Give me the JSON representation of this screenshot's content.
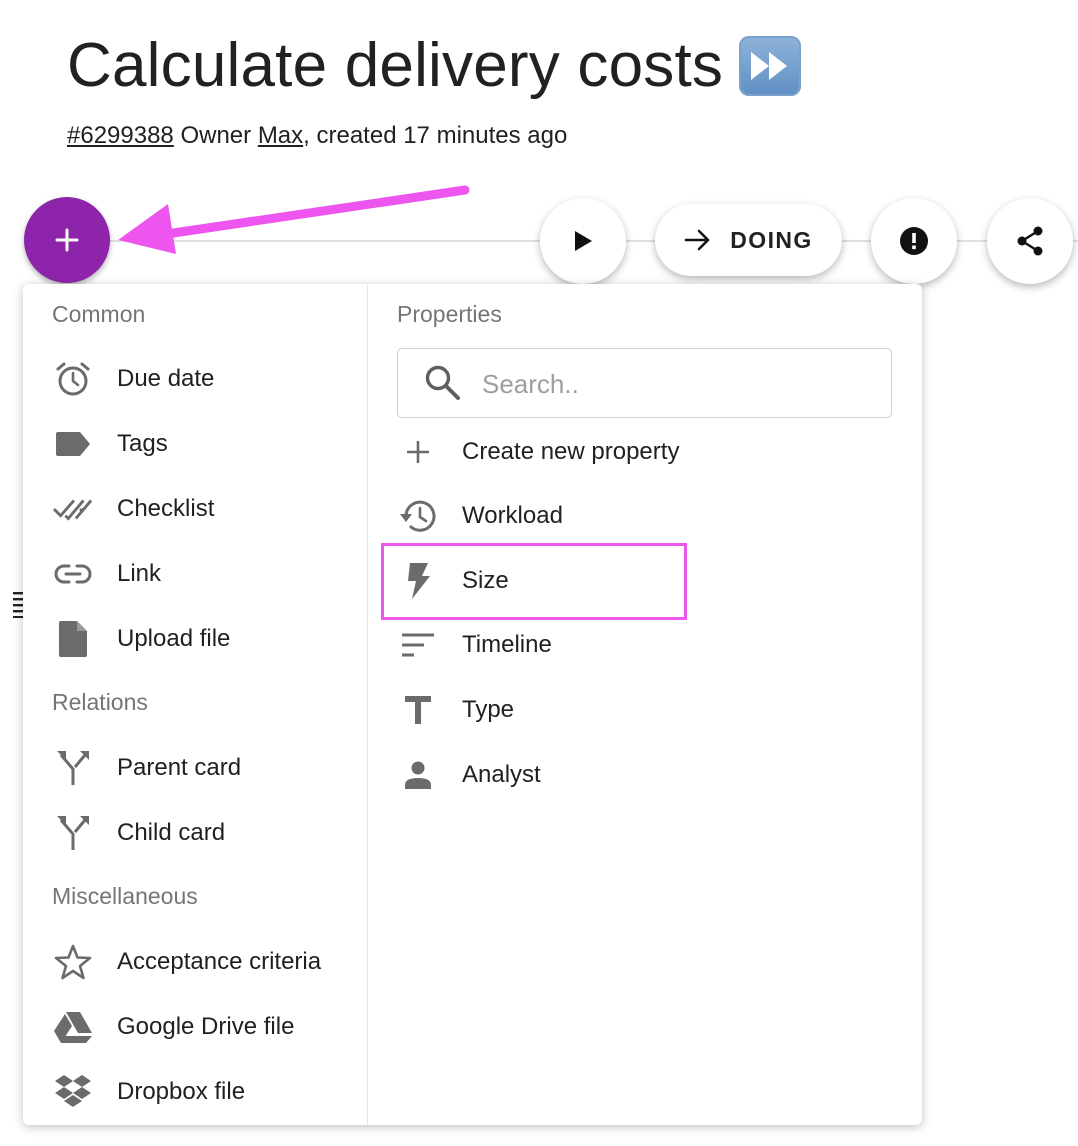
{
  "card": {
    "title": "Calculate delivery costs",
    "title_emoji": "fast-forward-emoji",
    "id": "#6299388",
    "owner_prefix": "Owner",
    "owner": "Max",
    "created": ", created 17 minutes ago"
  },
  "toolbar": {
    "add_icon": "plus-icon",
    "play_icon": "play-icon",
    "status_label": "DOING",
    "status_icon": "arrow-right-icon",
    "alert_icon": "exclamation-icon",
    "share_icon": "share-icon"
  },
  "menu": {
    "common": {
      "heading": "Common",
      "items": [
        {
          "label": "Due date",
          "icon": "alarm-clock-icon"
        },
        {
          "label": "Tags",
          "icon": "tag-icon"
        },
        {
          "label": "Checklist",
          "icon": "double-check-icon"
        },
        {
          "label": "Link",
          "icon": "link-icon"
        },
        {
          "label": "Upload file",
          "icon": "file-icon"
        }
      ]
    },
    "relations": {
      "heading": "Relations",
      "items": [
        {
          "label": "Parent card",
          "icon": "merge-icon"
        },
        {
          "label": "Child card",
          "icon": "merge-icon"
        }
      ]
    },
    "misc": {
      "heading": "Miscellaneous",
      "items": [
        {
          "label": "Acceptance criteria",
          "icon": "star-outline-icon"
        },
        {
          "label": "Google Drive file",
          "icon": "google-drive-icon"
        },
        {
          "label": "Dropbox file",
          "icon": "dropbox-icon"
        }
      ]
    },
    "properties": {
      "heading": "Properties",
      "search_placeholder": "Search..",
      "items": [
        {
          "label": "Create new property",
          "icon": "plus-icon"
        },
        {
          "label": "Workload",
          "icon": "history-icon"
        },
        {
          "label": "Size",
          "icon": "lightning-bolt-icon"
        },
        {
          "label": "Timeline",
          "icon": "sort-lines-icon"
        },
        {
          "label": "Type",
          "icon": "text-t-icon"
        },
        {
          "label": "Analyst",
          "icon": "person-icon"
        }
      ]
    }
  },
  "colors": {
    "fab": "#8e24aa",
    "annotation": "#ee55ee",
    "icon_gray": "#6b6b6b"
  }
}
